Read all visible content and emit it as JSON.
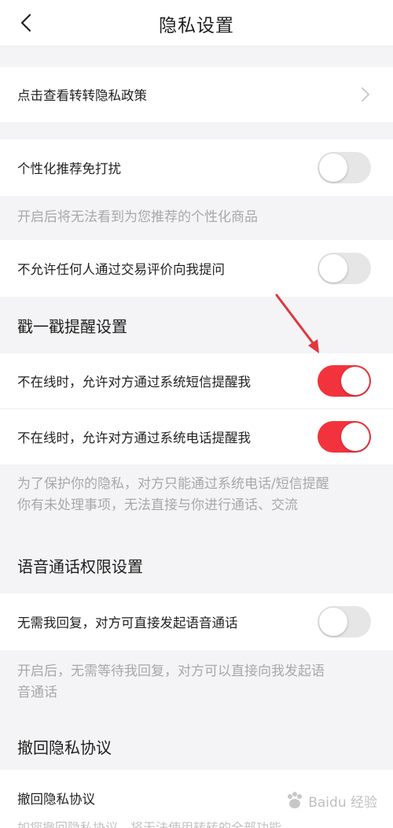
{
  "header": {
    "title": "隐私设置",
    "back_icon": "chevron-left-icon"
  },
  "privacy_policy": {
    "label": "点击查看转转隐私政策",
    "icon": "chevron-right-icon"
  },
  "personalized": {
    "label": "个性化推荐免打扰",
    "toggle_on": false,
    "description": "开启后将无法看到为您推荐的个性化商品"
  },
  "no_questions": {
    "label": "不允许任何人通过交易评价向我提问",
    "toggle_on": false
  },
  "poke_section": {
    "title": "戳一戳提醒设置",
    "sms_label": "不在线时，允许对方通过系统短信提醒我",
    "sms_toggle_on": true,
    "phone_label": "不在线时，允许对方通过系统电话提醒我",
    "phone_toggle_on": true,
    "description_line1": "为了保护你的隐私，对方只能通过系统电话/短信提醒",
    "description_line2": "你有未处理事项，无法直接与你进行通话、交流"
  },
  "voice_section": {
    "title": "语音通话权限设置",
    "label": "无需我回复，对方可直接发起语音通话",
    "toggle_on": false,
    "description_line1": "开启后，无需等待我回复，对方可以直接向我发起语",
    "description_line2": "音通话"
  },
  "revoke_section": {
    "title": "撤回隐私协议",
    "label": "撤回隐私协议",
    "cut_text": "如您撤回隐私协议，将无法使用转转的全部功能"
  },
  "watermark": {
    "text": "Baidu 经验"
  },
  "colors": {
    "accent": "#f2333d",
    "annotation_arrow": "#e0373f"
  }
}
